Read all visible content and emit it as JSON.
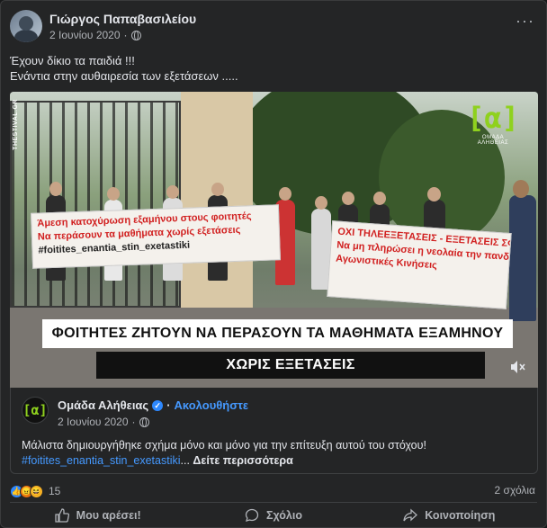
{
  "post": {
    "author": "Γιώργος Παπαβασιλείου",
    "date": "2 Ιουνίου 2020",
    "privacy_icon": "globe-icon",
    "text_line1": "Έχουν δίκιο τα παιδιά !!!",
    "text_line2": "Ενάντια στην αυθαιρεσία των εξετάσεων ....."
  },
  "video": {
    "watermark": "THESTIVAL.GR",
    "logo_mark": "[α]",
    "logo_text": "ΟΜΑΔΑ ΑΛΗΘΕΙΑΣ",
    "caption_line1": "ΦΟΙΤΗΤΕΣ ΖΗΤΟΥΝ ΝΑ ΠΕΡΑΣΟΥΝ ΤΑ ΜΑΘΗΜΑΤΑ ΕΞΑΜΗΝΟΥ",
    "caption_line2": "ΧΩΡΙΣ ΕΞΕΤΑΣΕΙΣ",
    "banner_left_line1": "Άμεση κατοχύρωση εξαμήνου στους φοιτητές",
    "banner_left_line2": "Να περάσουν τα μαθήματα χωρίς εξετάσεις",
    "banner_left_line3": "#foitites_enantia_stin_exetastiki",
    "banner_right_line1": "ΟΧΙ ΤΗΛΕΕΞΕΤΑΣΕΙΣ - ΕΞΕΤΑΣΕΙΣ ΣΦΑΓΕΙΟ",
    "banner_right_line2": "Να μη πληρώσει η νεολαία την πανδημία",
    "banner_right_line3": "Αγωνιστικές Κινήσεις"
  },
  "shared": {
    "page_name": "Ομάδα Αλήθειας",
    "avatar_mark": "[α]",
    "separator": "·",
    "follow_label": "Ακολουθήστε",
    "date": "2 Ιουνίου 2020",
    "text": "Μάλιστα δημιουργήθηκε σχήμα μόνο και μόνο για την επίτευξη αυτού του στόχου!",
    "hashtag": "#foitites_enantia_stin_exetastiki",
    "ellipsis": "...",
    "see_more": "Δείτε περισσότερα"
  },
  "stats": {
    "reaction_count": "15",
    "comments": "2 σχόλια"
  },
  "actions": {
    "like": "Μου αρέσει!",
    "comment": "Σχόλιο",
    "share": "Κοινοποίηση"
  },
  "colors": {
    "background": "#242526",
    "text": "#e4e6eb",
    "secondary": "#b0b3b8",
    "link": "#4599ff",
    "logo_green": "#8fd11e"
  }
}
